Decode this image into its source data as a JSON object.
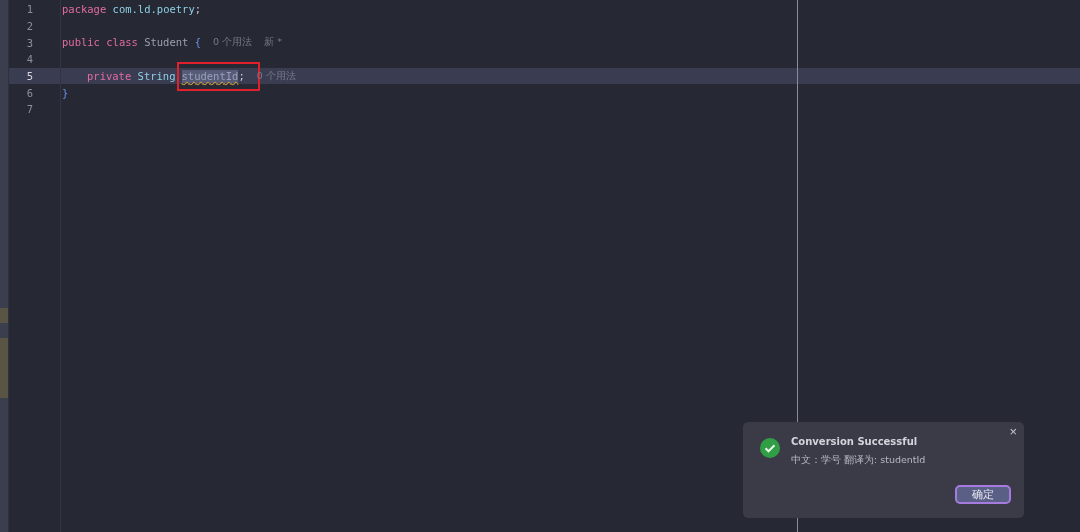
{
  "editor": {
    "lines": [
      {
        "number": "1",
        "current": false,
        "tokens": [
          {
            "kind": "keyword",
            "text": "package"
          },
          {
            "kind": "name",
            "text": "com.ld.poetry"
          },
          {
            "kind": "plain",
            "text": ";"
          }
        ]
      },
      {
        "number": "2",
        "current": false
      },
      {
        "number": "3",
        "current": false,
        "tokens": [
          {
            "kind": "keyword",
            "text": "public"
          },
          {
            "kind": "keyword",
            "text": "class"
          },
          {
            "kind": "type",
            "text": "Student"
          },
          {
            "kind": "brace",
            "text": "{"
          },
          {
            "kind": "hint",
            "text": "0 个用法"
          },
          {
            "kind": "hint",
            "text": "新 *"
          }
        ]
      },
      {
        "number": "4",
        "current": false
      },
      {
        "number": "5",
        "current": true,
        "indented": true,
        "tokens": [
          {
            "kind": "keyword",
            "text": "private"
          },
          {
            "kind": "name",
            "text": "String"
          },
          {
            "kind": "selection",
            "text": "studentId",
            "marked": true
          },
          {
            "kind": "plain",
            "text": ";"
          },
          {
            "kind": "hint",
            "text": "0 个用法"
          }
        ]
      },
      {
        "number": "6",
        "current": false,
        "tokens": [
          {
            "kind": "brace",
            "text": "}"
          }
        ]
      },
      {
        "number": "7",
        "current": false
      }
    ]
  },
  "notification": {
    "title": "Conversion Successful",
    "message": "中文：学号 翻译为: studentId",
    "button": "确定",
    "close": "×"
  }
}
